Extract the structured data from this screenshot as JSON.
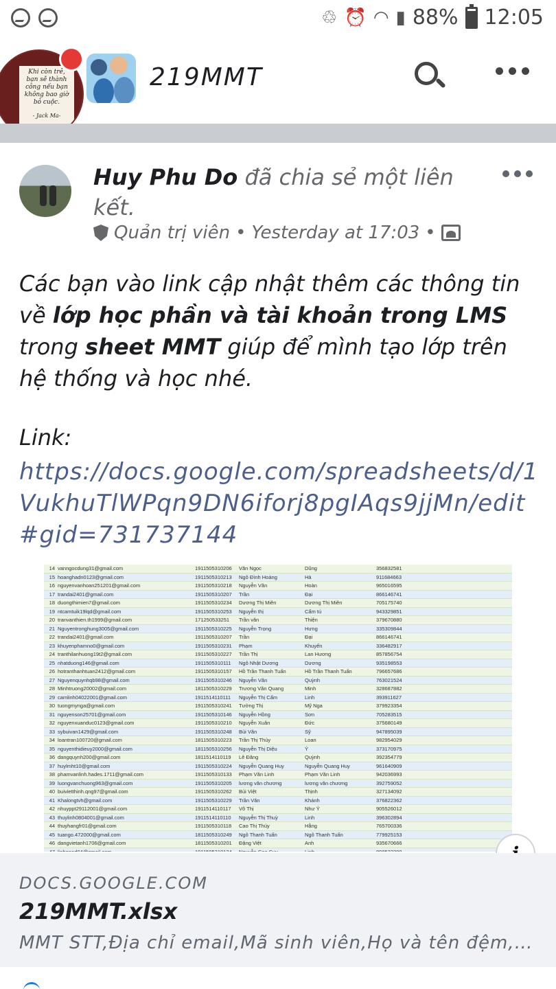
{
  "status_bar": {
    "battery_percent": "88%",
    "time": "12:05",
    "icons": [
      "messenger-icon",
      "messenger-icon",
      "cleaner-icon",
      "alarm-icon",
      "wifi-icon",
      "signal-icon",
      "battery-icon"
    ]
  },
  "group_header": {
    "quote_text": "Khi còn trẻ, bạn sẽ thành công nếu bạn không bao giờ bỏ cuộc.",
    "quote_author": "- Jack Ma-",
    "group_name": "219MMT",
    "icons": [
      "search-icon",
      "more-icon"
    ],
    "badge_color": "#e53935"
  },
  "post": {
    "author": "Huy Phu Do",
    "action": "đã chia sẻ một liên kết.",
    "role": "Quản trị viên",
    "separator": "•",
    "time": "Yesterday at 17:03",
    "body_parts": [
      {
        "text": "Các bạn vào link cập nhật thêm các thông tin về ",
        "bold": false
      },
      {
        "text": "lớp học phần và tài khoản trong LMS",
        "bold": true
      },
      {
        "text": " trong ",
        "bold": false
      },
      {
        "text": "sheet MMT",
        "bold": true
      },
      {
        "text": " giúp để mình tạo lớp trên hệ thống và học nhé.",
        "bold": false
      }
    ],
    "link_label": "Link:",
    "link_url": "https://docs.google.com/spreadsheets/d/1VukhuTlWPqn9DN6iforj8pgIAqs9jjMn/edit#gid=731737144",
    "link_color": "#4b5e8c"
  },
  "sheet_preview": {
    "rows": [
      [
        "14",
        "vanngocdung31@gmail.com",
        "1911505310206",
        "Văn Ngọc",
        "Dũng",
        "356832581"
      ],
      [
        "15",
        "hoanghadn0123@gmail.com",
        "1911505310213",
        "Ngô Đình Hoàng",
        "Hà",
        "911684663"
      ],
      [
        "16",
        "nguyenvanhoan251201@gmail.com",
        "1911505310218",
        "Nguyễn Văn",
        "Hoàn",
        "965016595"
      ],
      [
        "17",
        "trandai2401@gmail.com",
        "1911505310207",
        "Trần",
        "Đại",
        "866146741"
      ],
      [
        "18",
        "duongthimien7@gmail.com",
        "1911505310234",
        "Dương Thị Miên",
        "Dương Thị Miên",
        "705175740"
      ],
      [
        "19",
        "ntcamtuik19lqd@gmail.com",
        "1911505310253",
        "Nguyễn thị",
        "Cẩm tú",
        "943329851"
      ],
      [
        "20",
        "tranvanthien.th1999@gmail.com",
        "171250533251",
        "Trần văn",
        "Thiện",
        "379670880"
      ],
      [
        "21",
        "Nguyentronghung3005@gmail.com",
        "1911505310225",
        "Nguyễn Trọng",
        "Hưng",
        "335309844"
      ],
      [
        "22",
        "trandai2401@gmail.com",
        "1911505310207",
        "Trần",
        "Đại",
        "866146741"
      ],
      [
        "23",
        "khuyenphamno0@gmail.com",
        "1911505310231",
        "Phạm",
        "Khuyến",
        "336482917"
      ],
      [
        "24",
        "tranthilanhuong19t2@gmail.com",
        "1911505310227",
        "Trần Thị",
        "Lan Hương",
        "857856754"
      ],
      [
        "25",
        "nhatduong146@gmail.com",
        "1911505310111",
        "Ngô Nhật Dương",
        "Dương",
        "935198553"
      ],
      [
        "26",
        "hotranthanhtuan2412@gmail.com",
        "1911505310157",
        "Hồ Trần Thanh Tuấn",
        "Hồ Trần Thanh Tuấn",
        "796657686"
      ],
      [
        "27",
        "Nguyenquynhqb98@gmail.com",
        "1911505310246",
        "Nguyễn Văn",
        "Quỳnh",
        "763021524"
      ],
      [
        "28",
        "Minhtruong20002@gmail.com",
        "1811505310229",
        "Trương Văn Quang",
        "Minh",
        "328687882"
      ],
      [
        "29",
        "camlinh04022001@gmail.com",
        "1911514110111",
        "Nguyễn Thị Cẩm",
        "Linh",
        "393911627"
      ],
      [
        "30",
        "tuongmynga@gmail.com",
        "1911505310241",
        "Tưởng Thị",
        "Mỹ Nga",
        "379923354"
      ],
      [
        "31",
        "nguyenson25701@gmail.com",
        "1911505310146",
        "Nguyễn Hồng",
        "Sơn",
        "705283515"
      ],
      [
        "32",
        "nguyenxuanduc0123@gmail.com",
        "1911505310210",
        "Nguyễn Xuân",
        "Đức",
        "375680149"
      ],
      [
        "33",
        "sybuivan1429@gmail.com",
        "1911505310248",
        "Bùi Văn",
        "Sỹ",
        "947895039"
      ],
      [
        "34",
        "loantran100720@gmail.com",
        "1811505310223",
        "Trần Thị Thúy",
        "Loan",
        "982954029"
      ],
      [
        "35",
        "nguyenthidieuy2000@gmail.com",
        "1811505310256",
        "Nguyễn Thị Diệu",
        "Ý",
        "373170975"
      ],
      [
        "36",
        "dangquynh200@gmail.com",
        "1811514110119",
        "Lê Đăng",
        "Quỳnh",
        "392354779"
      ],
      [
        "37",
        "huylmht10@gmail.com",
        "1911505310224",
        "Nguyễn Quang Huy",
        "Nguyễn Quang Huy",
        "961640909"
      ],
      [
        "38",
        "phamvanlinh.hades.1711@gmail.com",
        "1911505310133",
        "Phạm Văn Linh",
        "Phạm Văn Linh",
        "942036993"
      ],
      [
        "39",
        "luongvanchuong963@gmail.com",
        "1911505310205",
        "lương văn chương",
        "lương văn chương",
        "392759052"
      ],
      [
        "40",
        "buivietthinh.qng97@gmail.com",
        "1911505310262",
        "Bùi Việt",
        "Thịnh",
        "327134092"
      ],
      [
        "41",
        "Khalongtvh@gmail.com",
        "1911505310229",
        "Trần Văn",
        "Khánh",
        "376822362"
      ],
      [
        "42",
        "nhuyppt29112001@gmail.com",
        "1911514110117",
        "Võ Thị",
        "Như Ý",
        "905526012"
      ],
      [
        "43",
        "thuylinh0804001@gmail.com",
        "1911514110110",
        "Nguyễn Thị Thuỳ",
        "Linh",
        "396302894"
      ],
      [
        "44",
        "thuyhangfr01@gmail.com",
        "1911505310118",
        "Cao Thị Thúy",
        "Hằng",
        "765700336"
      ],
      [
        "45",
        "tuango.472000@gmail.com",
        "1811505310249",
        "Ngô Thanh Tuấn",
        "Ngô Thanh Tuấn",
        "779925153"
      ],
      [
        "46",
        "dangvietanh1706@gmail.com",
        "1811505310201",
        "Đặng Việt",
        "Anh",
        "935670666"
      ],
      [
        "47",
        "linhgood04@gmail.com",
        "1911505310134",
        "Nguyễn Cao Suy",
        "Linh",
        "898522390"
      ]
    ]
  },
  "link_card": {
    "info_label": "i",
    "domain": "DOCS.GOOGLE.COM",
    "title": "219MMT.xlsx",
    "description": "MMT STT,Địa chỉ email,Mã sinh viên,Họ và tên đệm,T..."
  }
}
